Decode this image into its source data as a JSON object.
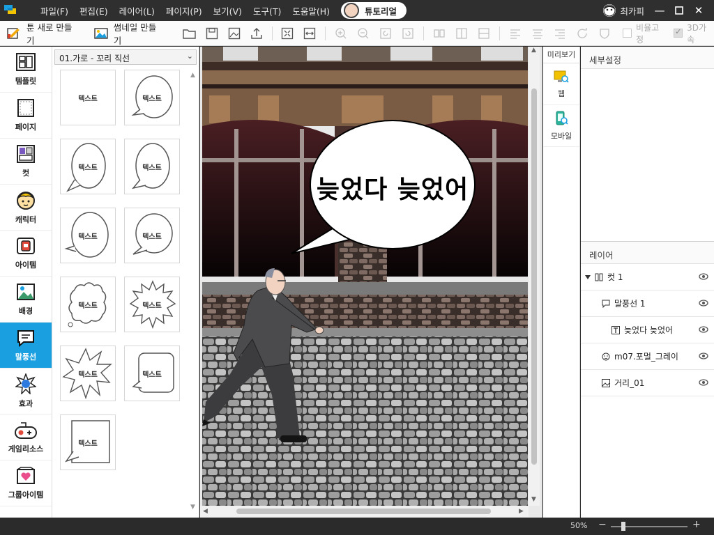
{
  "menu": {
    "items": [
      "파일(F)",
      "편집(E)",
      "레이어(L)",
      "페이지(P)",
      "보기(V)",
      "도구(T)",
      "도움말(H)"
    ],
    "tutorial": "튜토리얼",
    "user": "최카피"
  },
  "toolbar": {
    "new_toon": "툰 새로 만들기",
    "thumbnail": "썸네일 만들기",
    "aspect_lock": "비율고정",
    "accel_3d": "3D가속"
  },
  "leftnav": [
    {
      "label": "템플릿"
    },
    {
      "label": "페이지"
    },
    {
      "label": "컷"
    },
    {
      "label": "캐릭터"
    },
    {
      "label": "아이템"
    },
    {
      "label": "배경"
    },
    {
      "label": "말풍선"
    },
    {
      "label": "효과"
    },
    {
      "label": "게임리소스"
    },
    {
      "label": "그룹아이템"
    }
  ],
  "palette": {
    "category": "01.가로 - 꼬리 직선",
    "cell_label": "텍스트"
  },
  "canvas": {
    "bubble_text": "늦었다 늦었어"
  },
  "preview": {
    "title": "미리보기",
    "web": "웹",
    "mobile": "모바일"
  },
  "detail": {
    "title": "세부설정"
  },
  "layers": {
    "title": "레이어",
    "rows": [
      {
        "name": "컷 1"
      },
      {
        "name": "말풍선 1"
      },
      {
        "name": "늦었다 늦었어"
      },
      {
        "name": "m07.포멀_그레이"
      },
      {
        "name": "거리_01"
      }
    ]
  },
  "status": {
    "zoom": "50%"
  },
  "colors": {
    "accent": "#1aa0e0",
    "titlebar": "#2f2f2f"
  }
}
